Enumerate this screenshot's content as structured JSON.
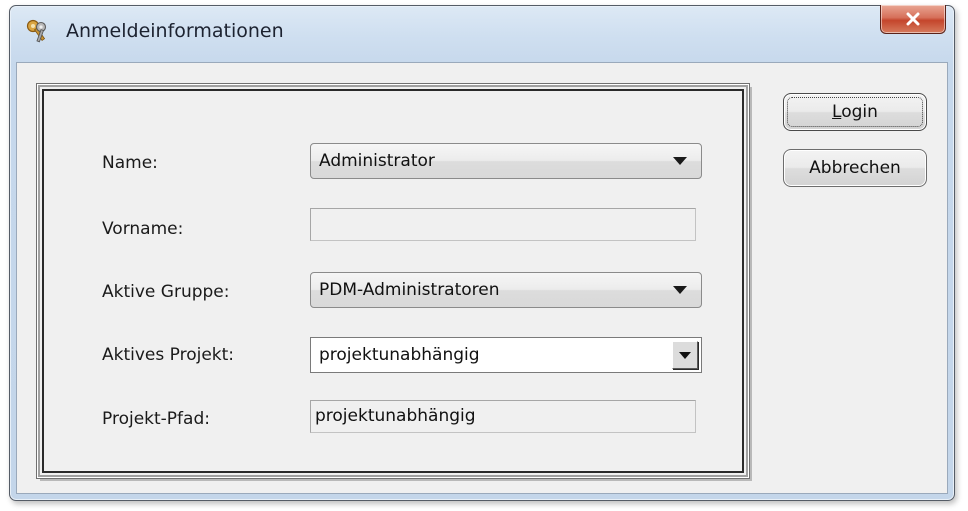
{
  "window": {
    "title": "Anmeldeinformationen",
    "icon": "keys-icon",
    "close_glyph": "x"
  },
  "form": {
    "name_label": "Name:",
    "name_value": "Administrator",
    "vorname_label": "Vorname:",
    "vorname_value": "",
    "gruppe_label": "Aktive Gruppe:",
    "gruppe_value": "PDM-Administratoren",
    "projekt_label": "Aktives Projekt:",
    "projekt_value": "projektunabhängig",
    "pfad_label": "Projekt-Pfad:",
    "pfad_value": "projektunabhängig"
  },
  "buttons": {
    "login_label": "Login",
    "cancel_label": "Abbrechen"
  },
  "colors": {
    "titlebar": "#cfdff0",
    "close_button": "#c4452c",
    "dialog_background": "#f0f0f0"
  }
}
